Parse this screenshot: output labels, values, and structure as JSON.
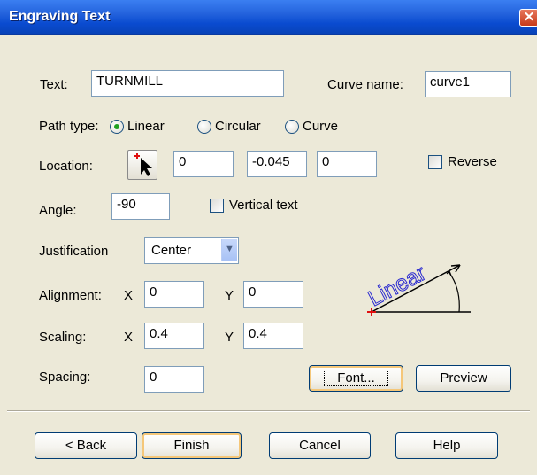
{
  "window": {
    "title": "Engraving Text",
    "close_icon": "close-icon"
  },
  "text_field": {
    "label": "Text:",
    "value": "TURNMILL"
  },
  "curve_name": {
    "label": "Curve name:",
    "value": "curve1"
  },
  "path_type": {
    "label": "Path type:",
    "options": [
      "Linear",
      "Circular",
      "Curve"
    ],
    "selected": "Linear"
  },
  "location": {
    "label": "Location:",
    "picker_icon": "pick-point-icon",
    "x": "0",
    "y": "-0.045",
    "z": "0"
  },
  "reverse": {
    "label": "Reverse",
    "checked": false
  },
  "angle": {
    "label": "Angle:",
    "value": "-90"
  },
  "vertical_text": {
    "label": "Vertical text",
    "checked": false
  },
  "justification": {
    "label": "Justification",
    "value": "Center"
  },
  "alignment": {
    "label": "Alignment:",
    "x_label": "X",
    "x": "0",
    "y_label": "Y",
    "y": "0"
  },
  "scaling": {
    "label": "Scaling:",
    "x_label": "X",
    "x": "0.4",
    "y_label": "Y",
    "y": "0.4"
  },
  "spacing": {
    "label": "Spacing:",
    "value": "0"
  },
  "preview_graphic": {
    "text": "Linear",
    "text_color": "#2a2ad0",
    "marker_color": "#e01010"
  },
  "buttons": {
    "font": "Font...",
    "preview": "Preview",
    "back": "< Back",
    "finish": "Finish",
    "cancel": "Cancel",
    "help": "Help"
  }
}
